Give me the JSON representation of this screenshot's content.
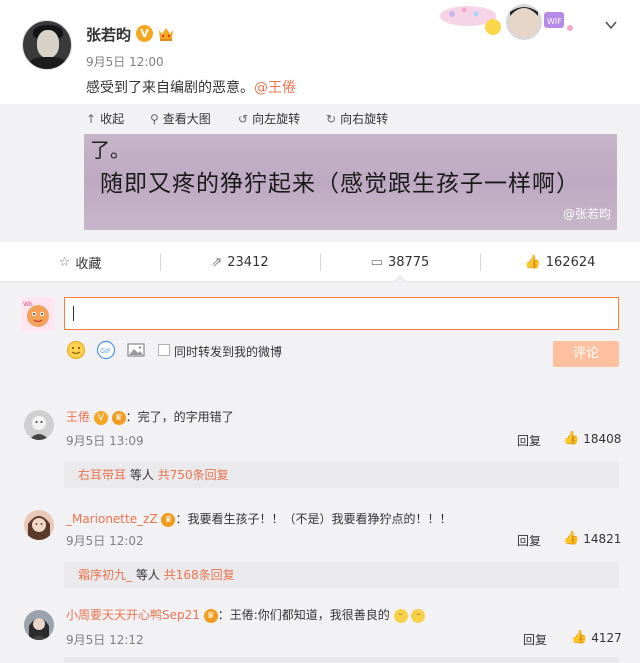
{
  "post": {
    "author": "张若昀",
    "time": "9月5日 12:00",
    "text": "感受到了来自编剧的恶意。",
    "mention": "@王倦"
  },
  "toolbar": {
    "collapse": "收起",
    "view_large": "查看大图",
    "rotate_left": "向左旋转",
    "rotate_right": "向右旋转"
  },
  "photo": {
    "line1": "了。",
    "line2": "随即又疼的狰狞起来（感觉跟生孩子一样啊）",
    "watermark": "@张若昀"
  },
  "actions": {
    "favorite": "收藏",
    "repost_count": "23412",
    "comment_count": "38775",
    "like_count": "162624"
  },
  "composer": {
    "repost_label": "同时转发到我的微博",
    "submit_label": "评论"
  },
  "comments": [
    {
      "name": "王倦",
      "text": "：完了，的字用错了",
      "time": "9月5日 13:09",
      "reply": "回复",
      "likes": "18408",
      "sub_user": "右耳带耳",
      "sub_mid": "等人",
      "sub_count": "共750条回复"
    },
    {
      "name": "_Marionette_zZ",
      "text": "：我要看生孩子！！（不是）我要看狰狞点的！！！",
      "time": "9月5日 12:02",
      "reply": "回复",
      "likes": "14821",
      "sub_user": "霜序初九_",
      "sub_mid": "等人",
      "sub_count": "共168条回复"
    },
    {
      "name": "小周要天天开心鸭Sep21",
      "text": "：王倦:你们都知道，我很善良的",
      "time": "9月5日 12:12",
      "reply": "回复",
      "likes": "4127"
    }
  ]
}
